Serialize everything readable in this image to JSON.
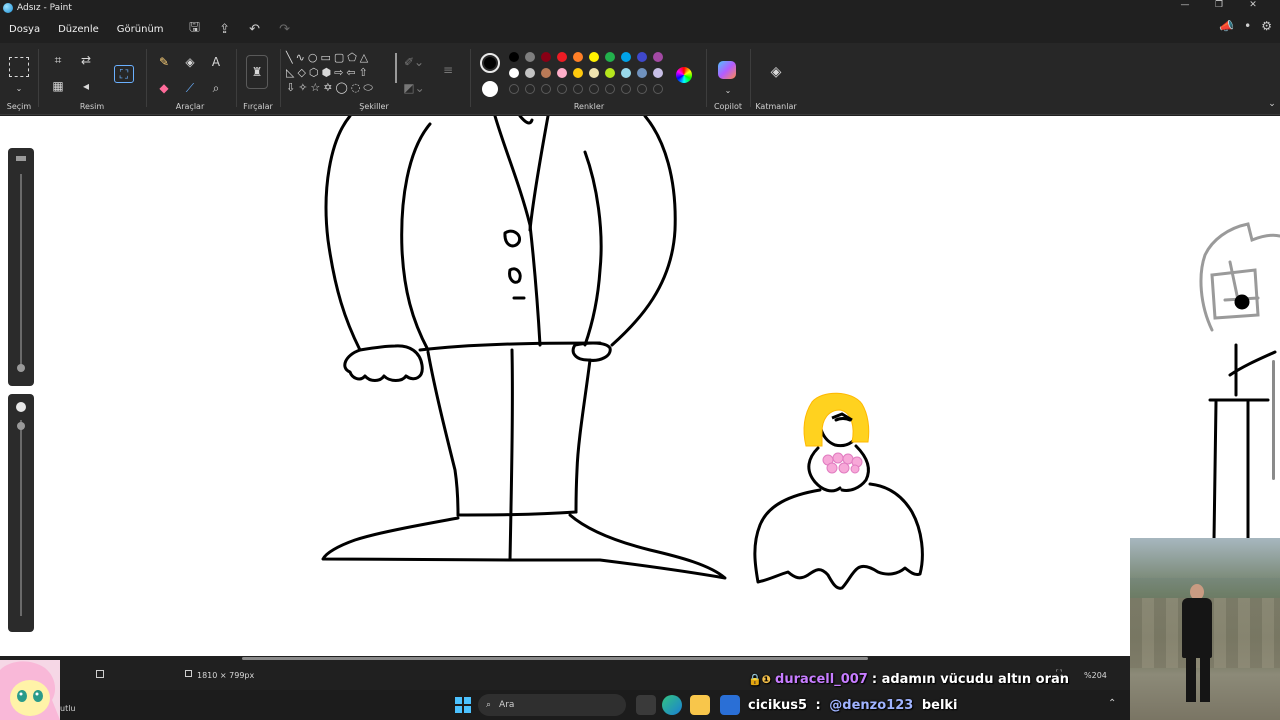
{
  "window": {
    "title": "Adsız - Paint"
  },
  "menu": {
    "items": [
      "Dosya",
      "Düzenle",
      "Görünüm"
    ]
  },
  "ribbon": {
    "groups": {
      "selection": "Seçim",
      "image": "Resim",
      "tools": "Araçlar",
      "brushes": "Fırçalar",
      "shapes": "Şekiller",
      "colors": "Renkler",
      "copilot": "Copilot",
      "layers": "Katmanlar"
    },
    "palette_row1": [
      "#000000",
      "#7f7f7f",
      "#880015",
      "#ed1c24",
      "#ff7f27",
      "#fff200",
      "#22b14c",
      "#00a2e8",
      "#3f48cc",
      "#a349a4"
    ],
    "palette_row2": [
      "#ffffff",
      "#c3c3c3",
      "#b97a57",
      "#ffaec9",
      "#ffc90e",
      "#efe4b0",
      "#b5e61d",
      "#99d9ea",
      "#7092be",
      "#c8bfe7"
    ],
    "primary_color": "#000000",
    "secondary_color": "#ffffff"
  },
  "status": {
    "canvas_size": "1810 × 799px",
    "zoom": "%204"
  },
  "taskbar": {
    "search_placeholder": "Ara",
    "left_label": "utlu"
  },
  "stream_chat": [
    {
      "user": "duracell_007",
      "user_color": "#c77dff",
      "message": ": adamın vücudu altın oran"
    },
    {
      "user": "cicikus5",
      "user_color": "#ffffff",
      "message": " : ",
      "mention": "@denzo123",
      "mention_color": "#9fb3ff",
      "tail": " belki"
    }
  ]
}
